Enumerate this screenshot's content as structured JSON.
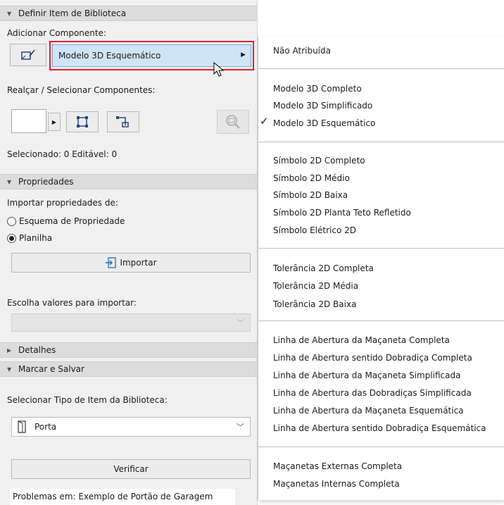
{
  "panel": {
    "section1": "Definir Item de Biblioteca",
    "add_component_label": "Adicionar Componente:",
    "component_dropdown_value": "Modelo 3D Esquemático",
    "highlight_label": "Realçar / Selecionar Componentes:",
    "selected_text": "Selecionado: 0 Editável: 0",
    "section2": "Propriedades",
    "import_from_label": "Importar propriedades de:",
    "radio_schema": "Esquema de Propriedade",
    "radio_sheet": "Planilha",
    "import_button": "Importar",
    "choose_values_label": "Escolha valores para importar:",
    "section3": "Detalhes",
    "section4": "Marcar e Salvar",
    "select_type_label": "Selecionar Tipo de Item da Biblioteca:",
    "type_value": "Porta",
    "verify_button": "Verificar",
    "problems_text": "Problemas em: Exemplo de Portão de Garagem"
  },
  "menu": {
    "items": [
      "Não Atribuída",
      "Modelo 3D Completo",
      "Modelo 3D Simplificado",
      "Modelo 3D Esquemático",
      "Símbolo 2D Completo",
      "Símbolo 2D Médio",
      "Símbolo 2D Baixa",
      "Símbolo 2D Planta Teto Refletido",
      "Símbolo Elétrico 2D",
      "Tolerância 2D Completa",
      "Tolerância 2D Média",
      "Tolerância 2D Baixa",
      "Linha de Abertura da Maçaneta Completa",
      "Linha de Abertura sentido Dobradiça Completa",
      "Linha de Abertura da Maçaneta Simplificada",
      "Linha de Abertura das Dobradiças Simplificada",
      "Linha de Abertura da Maçaneta Esquemática",
      "Linha de Abertura sentido Dobradiça Esquemática",
      "Maçanetas Externas Completa",
      "Maçanetas Internas Completa"
    ],
    "checked_item": "Modelo 3D Esquemático"
  },
  "colors": {
    "highlight_border": "#e0202a",
    "dropdown_fill": "#cfe4f7",
    "accent": "#2a6fb0"
  }
}
